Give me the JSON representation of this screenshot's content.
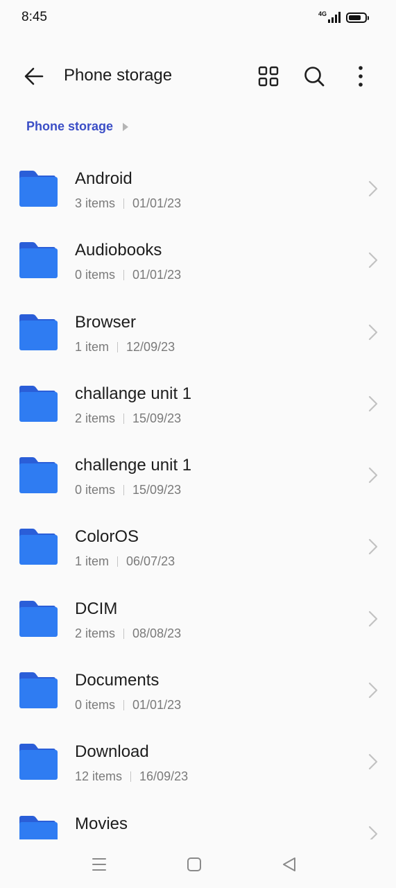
{
  "status_bar": {
    "time": "8:45",
    "network": "4G",
    "signal_level": 4,
    "battery_level": 0.75
  },
  "app_bar": {
    "title": "Phone storage",
    "icons": [
      "back-arrow-icon",
      "grid-view-icon",
      "search-icon",
      "more-vertical-icon"
    ]
  },
  "breadcrumb": {
    "label": "Phone storage"
  },
  "colors": {
    "accent": "#3b4ec6",
    "folder_front": "#2f7cf2",
    "folder_back": "#2a5ed8"
  },
  "folders": [
    {
      "name": "Android",
      "count": "3 items",
      "date": "01/01/23"
    },
    {
      "name": "Audiobooks",
      "count": "0 items",
      "date": "01/01/23"
    },
    {
      "name": "Browser",
      "count": "1 item",
      "date": "12/09/23"
    },
    {
      "name": "challange unit 1",
      "count": "2 items",
      "date": "15/09/23"
    },
    {
      "name": "challenge unit 1",
      "count": "0 items",
      "date": "15/09/23"
    },
    {
      "name": "ColorOS",
      "count": "1 item",
      "date": "06/07/23"
    },
    {
      "name": "DCIM",
      "count": "2 items",
      "date": "08/08/23"
    },
    {
      "name": "Documents",
      "count": "0 items",
      "date": "01/01/23"
    },
    {
      "name": "Download",
      "count": "12 items",
      "date": "16/09/23"
    },
    {
      "name": "Movies",
      "count": "",
      "date": ""
    }
  ],
  "nav_bar": {
    "icons": [
      "menu-icon",
      "home-icon",
      "back-icon"
    ]
  }
}
